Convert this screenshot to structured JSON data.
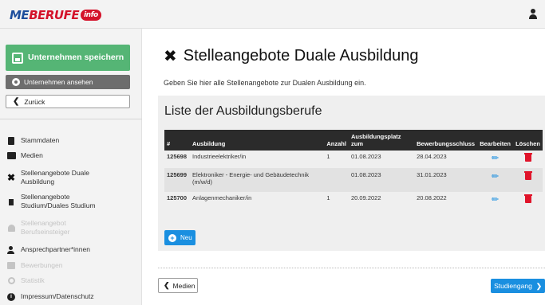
{
  "header": {
    "logo": {
      "part1": "ME",
      "part2": "BERUFE",
      "badge": "info"
    },
    "user_icon": "user-icon"
  },
  "sidebar": {
    "save_label": "Unternehmen speichern",
    "view_label": "Unternehmen ansehen",
    "back_label": "Zurück",
    "items": [
      {
        "label": "Stammdaten",
        "icon": "document-icon",
        "state": "normal"
      },
      {
        "label": "Medien",
        "icon": "images-icon",
        "state": "normal"
      },
      {
        "label": "Stellenangebote Duale Ausbildung",
        "icon": "tools-icon",
        "state": "active"
      },
      {
        "label": "Stellenangebote Studium/Duales Studium",
        "icon": "document-icon",
        "state": "normal"
      },
      {
        "label": "Stellenangebot Berufseinsteiger",
        "icon": "user-icon",
        "state": "disabled"
      },
      {
        "label": "Ansprechpartner*innen",
        "icon": "user-icon",
        "state": "normal"
      },
      {
        "label": "Bewerbungen",
        "icon": "box-icon",
        "state": "disabled"
      },
      {
        "label": "Statistik",
        "icon": "gear-icon",
        "state": "disabled"
      },
      {
        "label": "Impressum/Datenschutz",
        "icon": "info-icon",
        "state": "normal"
      }
    ]
  },
  "main": {
    "title": "Stelleangebote Duale Ausbildung",
    "subtitle": "Geben Sie hier alle Stellenangebote zur Dualen Ausbildung ein.",
    "list_title": "Liste der Ausbildungsberufe",
    "table": {
      "headers": {
        "num": "#",
        "ausbildung": "Ausbildung",
        "anzahl": "Anzahl",
        "platz_line1": "Ausbildungsplatz",
        "platz_line2": "zum",
        "schluss": "Bewerbungsschluss",
        "bearbeiten": "Bearbeiten",
        "loeschen": "Löschen"
      },
      "rows": [
        {
          "id": "125698",
          "ausbildung": "Industrieelektriker/in",
          "anzahl": "1",
          "zum": "01.08.2023",
          "schluss": "28.04.2023"
        },
        {
          "id": "125699",
          "ausbildung": "Elektroniker - Energie- und Gebäudetechnik (m/w/d)",
          "anzahl": "",
          "zum": "01.08.2023",
          "schluss": "31.01.2023"
        },
        {
          "id": "125700",
          "ausbildung": "Anlagenmechaniker/in",
          "anzahl": "1",
          "zum": "20.09.2022",
          "schluss": "20.08.2022"
        }
      ]
    },
    "new_label": "Neu",
    "prev_label": "Medien",
    "next_label": "Studiengang"
  },
  "colors": {
    "save_green": "#55b575",
    "primary_blue": "#1a8fe0",
    "delete_red": "#e0142a",
    "table_header": "#2b2b2b"
  }
}
